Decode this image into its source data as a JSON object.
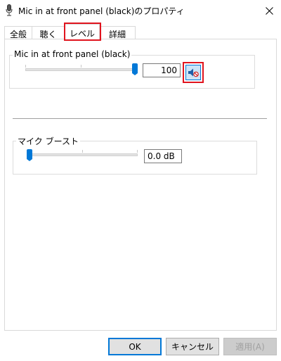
{
  "window": {
    "title": "Mic in at front panel (black)のプロパティ",
    "icon": "microphone-icon",
    "close_icon": "close-icon"
  },
  "tabs": [
    {
      "label": "全般",
      "selected": false
    },
    {
      "label": "聴く",
      "selected": false
    },
    {
      "label": "レベル",
      "selected": true
    },
    {
      "label": "詳細",
      "selected": false
    }
  ],
  "level_group": {
    "label": "Mic in at front panel (black)",
    "value": "100",
    "level": 100,
    "mute_icon": "speaker-muted-icon"
  },
  "boost_group": {
    "label": "マイク ブースト",
    "value": "0.0 dB",
    "level": 0
  },
  "buttons": {
    "ok": "OK",
    "cancel": "キャンセル",
    "apply": "適用(A)"
  },
  "colors": {
    "accent": "#0078d7",
    "highlight": "#e0141e"
  }
}
